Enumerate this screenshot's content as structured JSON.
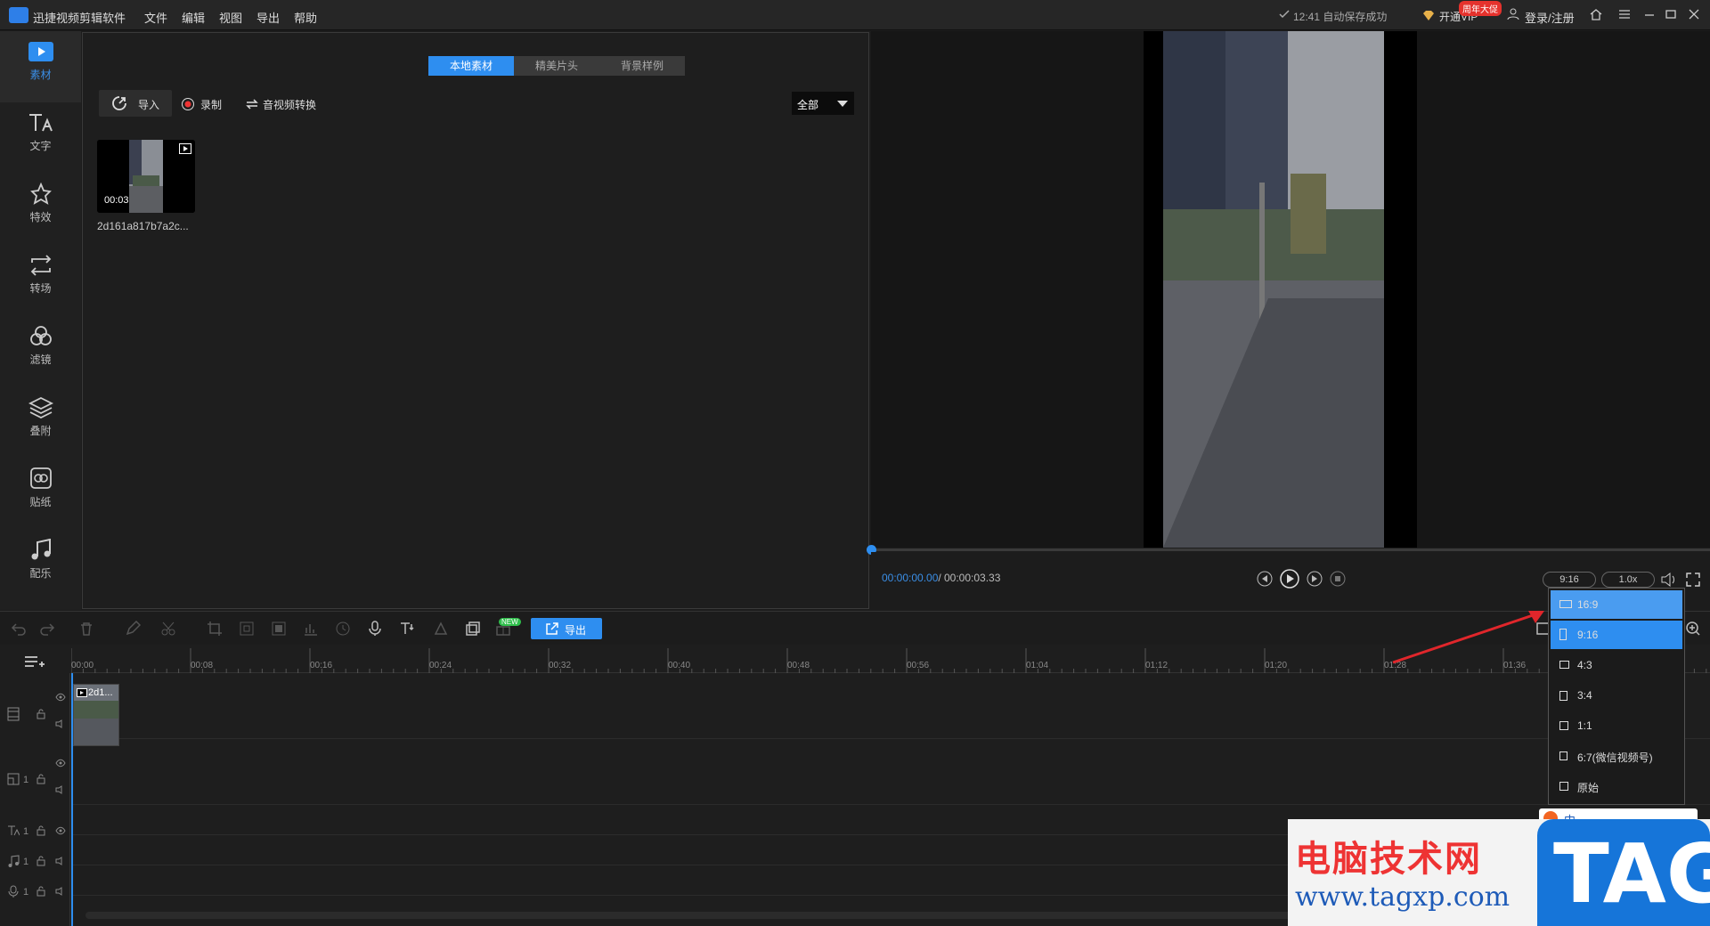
{
  "titlebar": {
    "app_title": "迅捷视频剪辑软件",
    "menu": [
      "文件",
      "编辑",
      "视图",
      "导出",
      "帮助"
    ],
    "save_status": "12:41 自动保存成功",
    "vip_label": "开通VIP",
    "vip_badge": "周年大促",
    "login_label": "登录/注册"
  },
  "sidebar": {
    "items": [
      {
        "label": "素材",
        "icon": "media-icon"
      },
      {
        "label": "文字",
        "icon": "text-icon"
      },
      {
        "label": "特效",
        "icon": "effects-icon"
      },
      {
        "label": "转场",
        "icon": "transition-icon"
      },
      {
        "label": "滤镜",
        "icon": "filter-icon"
      },
      {
        "label": "叠附",
        "icon": "overlay-icon"
      },
      {
        "label": "贴纸",
        "icon": "sticker-icon"
      },
      {
        "label": "配乐",
        "icon": "music-icon"
      }
    ]
  },
  "media": {
    "tabs": [
      "本地素材",
      "精美片头",
      "背景样例"
    ],
    "import_label": "导入",
    "record_label": "录制",
    "convert_label": "音视频转换",
    "filter_value": "全部",
    "items": [
      {
        "duration": "00:03",
        "name": "2d161a817b7a2c..."
      }
    ]
  },
  "preview": {
    "time_current": "00:00:00.00",
    "time_separator": " / ",
    "time_total": "00:00:03.33",
    "ratio_value": "9:16",
    "speed_value": "1.0x"
  },
  "toolbar": {
    "export_label": "导出",
    "new_badge": "NEW"
  },
  "timeline": {
    "ticks": [
      "00:00",
      "00:08",
      "00:16",
      "00:24",
      "00:32",
      "00:40",
      "00:48",
      "00:56",
      "01:04",
      "01:12",
      "01:20",
      "01:28",
      "01:36"
    ],
    "clip_label": "2d1...",
    "track_numbers": [
      "1",
      "1",
      "1",
      "1"
    ]
  },
  "ratio_menu": {
    "options": [
      "16:9",
      "9:16",
      "4:3",
      "3:4",
      "1:1",
      "6:7(微信视频号)",
      "原始"
    ],
    "hovered": "16:9",
    "selected": "9:16"
  },
  "watermark": {
    "title": "电脑技术网",
    "url": "www.tagxp.com",
    "tag": "TAG",
    "ime_text": "中"
  },
  "colors": {
    "accent": "#2e8ef0",
    "arrow": "#e0262b"
  }
}
